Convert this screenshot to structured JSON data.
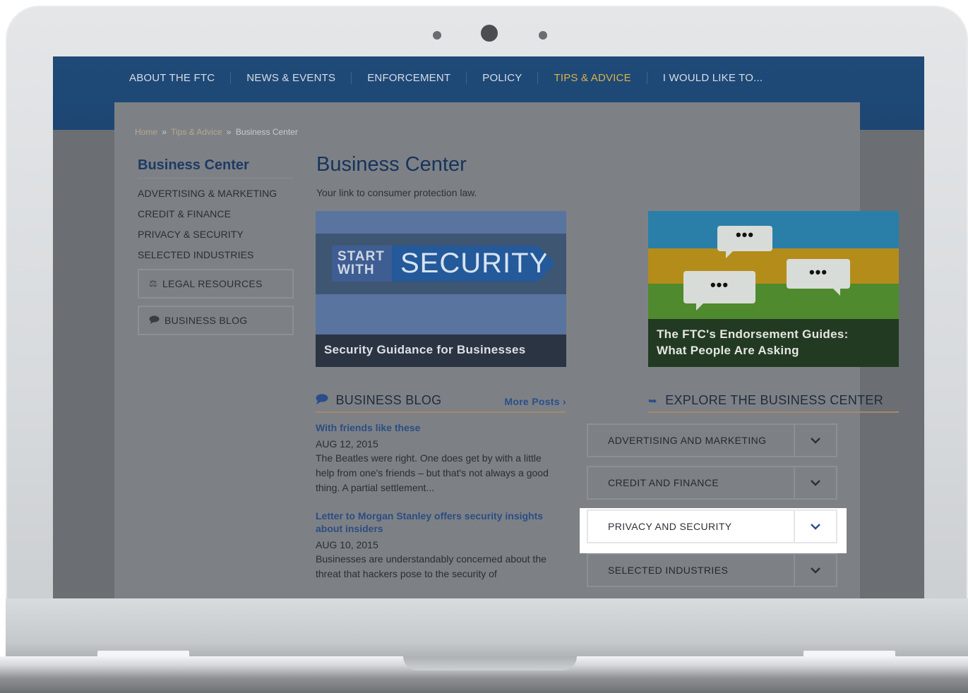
{
  "nav": {
    "items": [
      "ABOUT THE FTC",
      "NEWS & EVENTS",
      "ENFORCEMENT",
      "POLICY",
      "TIPS & ADVICE",
      "I WOULD LIKE TO..."
    ]
  },
  "breadcrumb": {
    "home": "Home",
    "sep": "»",
    "tips": "Tips & Advice",
    "current": "Business Center"
  },
  "sidebar": {
    "title": "Business Center",
    "links": [
      "ADVERTISING & MARKETING",
      "CREDIT & FINANCE",
      "PRIVACY & SECURITY",
      "SELECTED INDUSTRIES"
    ],
    "legal": "LEGAL RESOURCES",
    "blog": "BUSINESS BLOG"
  },
  "main": {
    "title": "Business Center",
    "subtitle": "Your link to consumer protection law."
  },
  "features": {
    "security": {
      "start_line1": "START",
      "start_line2": "WITH",
      "word": "SECURITY",
      "caption": "Security Guidance for Businesses"
    },
    "endorsement": {
      "bubble": "•••",
      "caption_line1": "The FTC's Endorsement Guides:",
      "caption_line2": "What People Are Asking"
    }
  },
  "blog": {
    "heading": "BUSINESS BLOG",
    "more": "More Posts ›",
    "posts": [
      {
        "title": "With friends like these",
        "date": "AUG 12, 2015",
        "excerpt": "The Beatles were right. One does get by with a little help from one's friends – but that's not always a good thing. A partial settlement..."
      },
      {
        "title": "Letter to Morgan Stanley offers security insights about insiders",
        "date": "AUG 10, 2015",
        "excerpt": "Businesses are understandably concerned about the threat that hackers pose to the security of"
      }
    ]
  },
  "explore": {
    "heading": "EXPLORE THE BUSINESS CENTER",
    "items": [
      "ADVERTISING AND MARKETING",
      "CREDIT AND FINANCE",
      "PRIVACY AND SECURITY",
      "SELECTED INDUSTRIES"
    ],
    "chevron": "⌄"
  },
  "colors": {
    "nav_bg": "#1f4a78",
    "nav_active": "#d9b24a",
    "link_blue": "#2c4d82",
    "highlight": "#ffffff"
  }
}
